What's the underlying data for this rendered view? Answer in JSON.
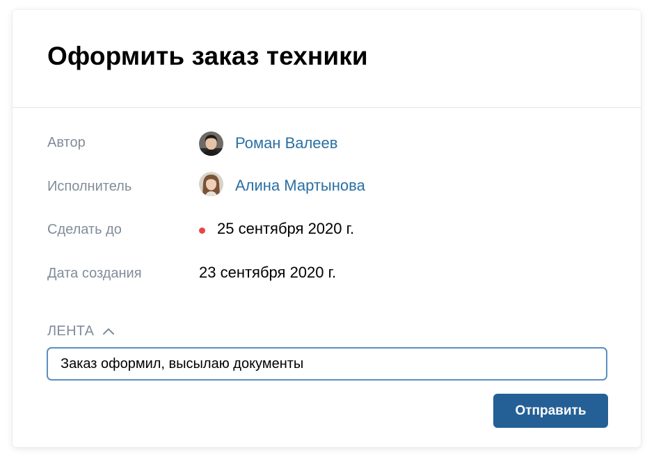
{
  "task": {
    "title": "Оформить заказ техники"
  },
  "details": {
    "author": {
      "label": "Автор",
      "name": "Роман Валеев",
      "avatar_icon": "avatar-photo-man"
    },
    "assignee": {
      "label": "Исполнитель",
      "name": "Алина Мартынова",
      "avatar_icon": "avatar-photo-woman"
    },
    "due_date": {
      "label": "Сделать до",
      "value": "25 сентября 2020 г.",
      "status_color": "#e64646"
    },
    "created_date": {
      "label": "Дата создания",
      "value": "23 сентября 2020 г."
    }
  },
  "feed": {
    "label": "ЛЕНТА",
    "toggle_icon": "chevron-up-icon",
    "comment_value": "Заказ оформил, высылаю документы",
    "send_label": "Отправить"
  },
  "colors": {
    "link": "#2a6fa3",
    "label": "#818c99",
    "primary_button": "#246095",
    "input_border": "#5b8ec1"
  }
}
